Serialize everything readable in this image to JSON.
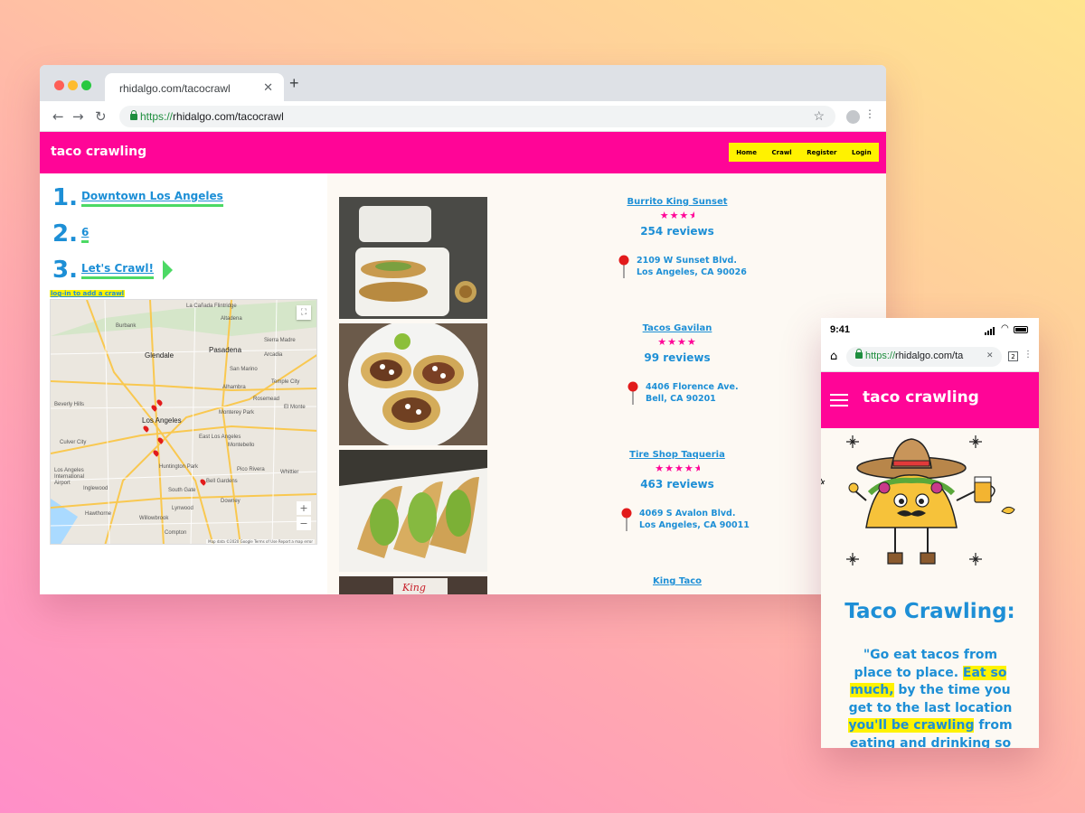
{
  "desktop": {
    "tab_title": "rhidalgo.com/tacocrawl",
    "url_protocol": "https://",
    "url_rest": "rhidalgo.com/tacocrawl",
    "site_logo": "taco crawling",
    "nav": [
      "Home",
      "Crawl",
      "Register",
      "Login"
    ],
    "steps": [
      {
        "num": "1.",
        "text": "Downtown Los Angeles"
      },
      {
        "num": "2.",
        "text": "6"
      },
      {
        "num": "3.",
        "text": "Let's Crawl!"
      }
    ],
    "login_note": "log-in to add a crawl",
    "map": {
      "labels": [
        "La Cañada Flintridge",
        "Altadena",
        "Burbank",
        "Pasadena",
        "Sierra Madre",
        "Arcadia",
        "Glendale",
        "San Marino",
        "Temple City",
        "Alhambra",
        "Rosemead",
        "Beverly Hills",
        "Los Angeles",
        "Monterey Park",
        "El Monte",
        "Culver City",
        "East Los Angeles",
        "Montebello",
        "Huntington Park",
        "Pico Rivera",
        "Whittier",
        "Los Angeles International Airport",
        "Inglewood",
        "South Gate",
        "Downey",
        "Bell Gardens",
        "Hawthorne",
        "Lynwood",
        "Willowbrook",
        "Compton"
      ],
      "attribution": "Map data ©2020 Google  Terms of Use  Report a map error",
      "zoom_in": "+",
      "zoom_out": "−"
    },
    "listings": [
      {
        "name": "Burrito King Sunset",
        "stars": "★★★★",
        "reviews": "254 reviews",
        "address_line1": "2109 W Sunset Blvd.",
        "address_line2": "Los Angeles, CA 90026"
      },
      {
        "name": "Tacos Gavilan",
        "stars": "★★★★",
        "reviews": "99 reviews",
        "address_line1": "4406 Florence Ave.",
        "address_line2": "Bell, CA 90201"
      },
      {
        "name": "Tire Shop Taqueria",
        "stars": "★★★★",
        "reviews": "463 reviews",
        "address_line1": "4069 S Avalon Blvd.",
        "address_line2": "Los Angeles, CA 90011"
      },
      {
        "name": "King Taco"
      }
    ],
    "ratings": [
      3.5,
      4,
      4.5
    ]
  },
  "mobile": {
    "time": "9:41",
    "url_protocol": "https://",
    "url_rest": "rhidalgo.com/ta",
    "tab_count": "2",
    "site_logo": "taco crawling",
    "title": "Taco Crawling:",
    "quote": {
      "p1": "\"Go eat tacos from place to place. ",
      "h1": "Eat so much,",
      "p2": " by the time you get to the last location ",
      "h2": "you'll be crawling",
      "p3": " from eating and drinking so"
    }
  },
  "colors": {
    "brand_pink": "#ff0597",
    "brand_blue": "#1d8fd6",
    "nav_yellow": "#fff200",
    "accent_green": "#4cd964"
  }
}
